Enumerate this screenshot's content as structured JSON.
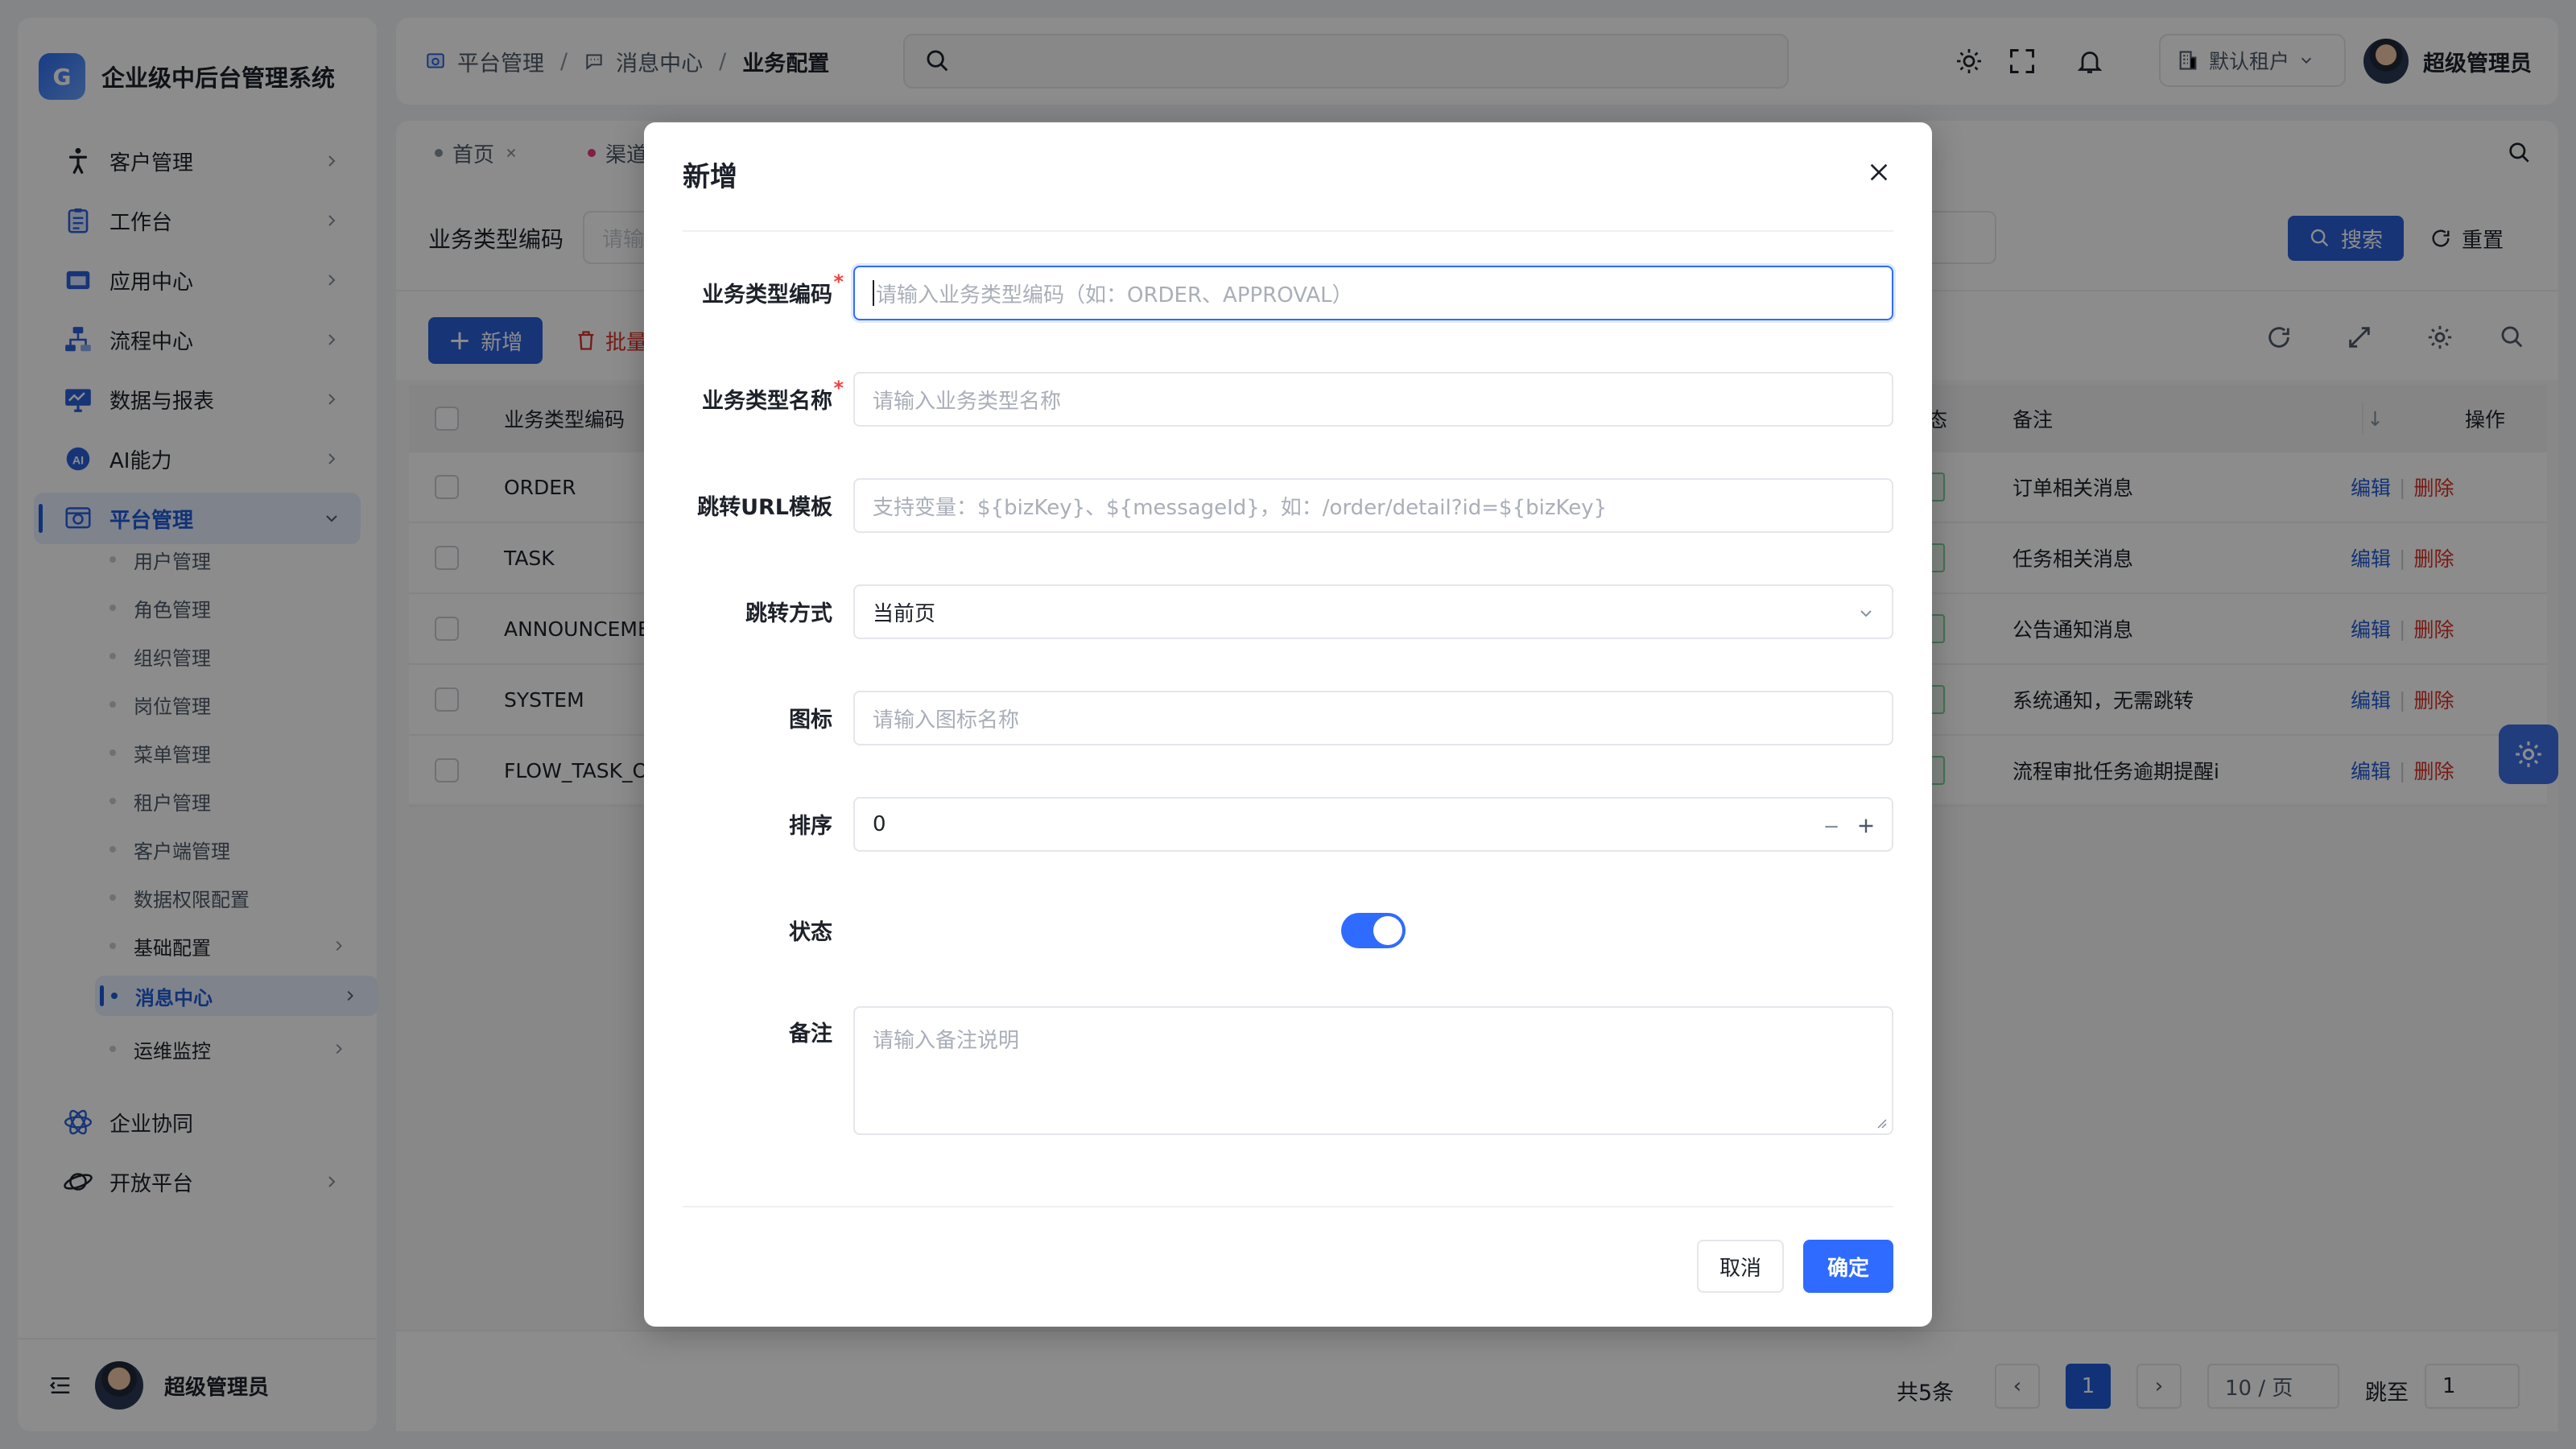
{
  "app": {
    "title": "企业级中后台管理系统",
    "logo_text": "G"
  },
  "sidebar": {
    "menu": [
      {
        "label": "客户管理",
        "icon": "person-walk-icon"
      },
      {
        "label": "工作台",
        "icon": "clipboard-icon"
      },
      {
        "label": "应用中心",
        "icon": "app-window-icon"
      },
      {
        "label": "流程中心",
        "icon": "flow-chart-icon"
      },
      {
        "label": "数据与报表",
        "icon": "monitor-chart-icon"
      },
      {
        "label": "AI能力",
        "icon": "ai-badge-icon"
      },
      {
        "label": "平台管理",
        "icon": "platform-icon",
        "expanded": true
      }
    ],
    "platform_children": [
      "用户管理",
      "角色管理",
      "组织管理",
      "岗位管理",
      "菜单管理",
      "租户管理",
      "客户端管理",
      "数据权限配置",
      "基础配置",
      "消息中心",
      "运维监控"
    ],
    "bottom_menu": [
      {
        "label": "企业协同",
        "icon": "atom-icon"
      },
      {
        "label": "开放平台",
        "icon": "planet-icon"
      }
    ],
    "footer_user": "超级管理员"
  },
  "header": {
    "breadcrumb": [
      "平台管理",
      "消息中心",
      "业务配置"
    ],
    "tenant": "默认租户",
    "user": "超级管理员"
  },
  "tabs": [
    {
      "label": "首页",
      "dot_color": "#86909c"
    },
    {
      "label": "渠道",
      "dot_color": "#e5397f"
    }
  ],
  "filter": {
    "label": "业务类型编码",
    "placeholder": "请输",
    "search_button": "搜索",
    "reset_button": "重置"
  },
  "toolbar": {
    "add_button": "新增",
    "batch_delete_button": "批量"
  },
  "table": {
    "columns": {
      "code": "业务类型编码",
      "status": "态",
      "remark": "备注",
      "ops": "操作"
    },
    "rows": [
      {
        "code": "ORDER",
        "remark": "订单相关消息"
      },
      {
        "code": "TASK",
        "remark": "任务相关消息"
      },
      {
        "code": "ANNOUNCEME",
        "remark": "公告通知消息"
      },
      {
        "code": "SYSTEM",
        "remark": "系统通知，无需跳转"
      },
      {
        "code": "FLOW_TASK_O",
        "remark": "流程审批任务逾期提醒i"
      }
    ],
    "edit_label": "编辑",
    "divider": "|",
    "delete_label": "删除"
  },
  "pagination": {
    "total": "共5条",
    "current_page": "1",
    "page_size": "10 / 页",
    "jump_label": "跳至",
    "jump_value": "1"
  },
  "modal": {
    "title": "新增",
    "fields": {
      "code": {
        "label": "业务类型编码",
        "placeholder": "请输入业务类型编码（如：ORDER、APPROVAL）"
      },
      "name": {
        "label": "业务类型名称",
        "placeholder": "请输入业务类型名称"
      },
      "url": {
        "label": "跳转URL模板",
        "placeholder": "支持变量：${bizKey}、${messageId}，如：/order/detail?id=${bizKey}"
      },
      "mode": {
        "label": "跳转方式",
        "value": "当前页"
      },
      "icon": {
        "label": "图标",
        "placeholder": "请输入图标名称"
      },
      "sort": {
        "label": "排序",
        "value": "0"
      },
      "status": {
        "label": "状态",
        "enabled": true
      },
      "remark": {
        "label": "备注",
        "placeholder": "请输入备注说明"
      }
    },
    "required_mark": "*",
    "cancel": "取消",
    "ok": "确定"
  },
  "colors": {
    "primary": "#2f6bff",
    "danger": "#d93026",
    "link": "#1f5bd8"
  }
}
